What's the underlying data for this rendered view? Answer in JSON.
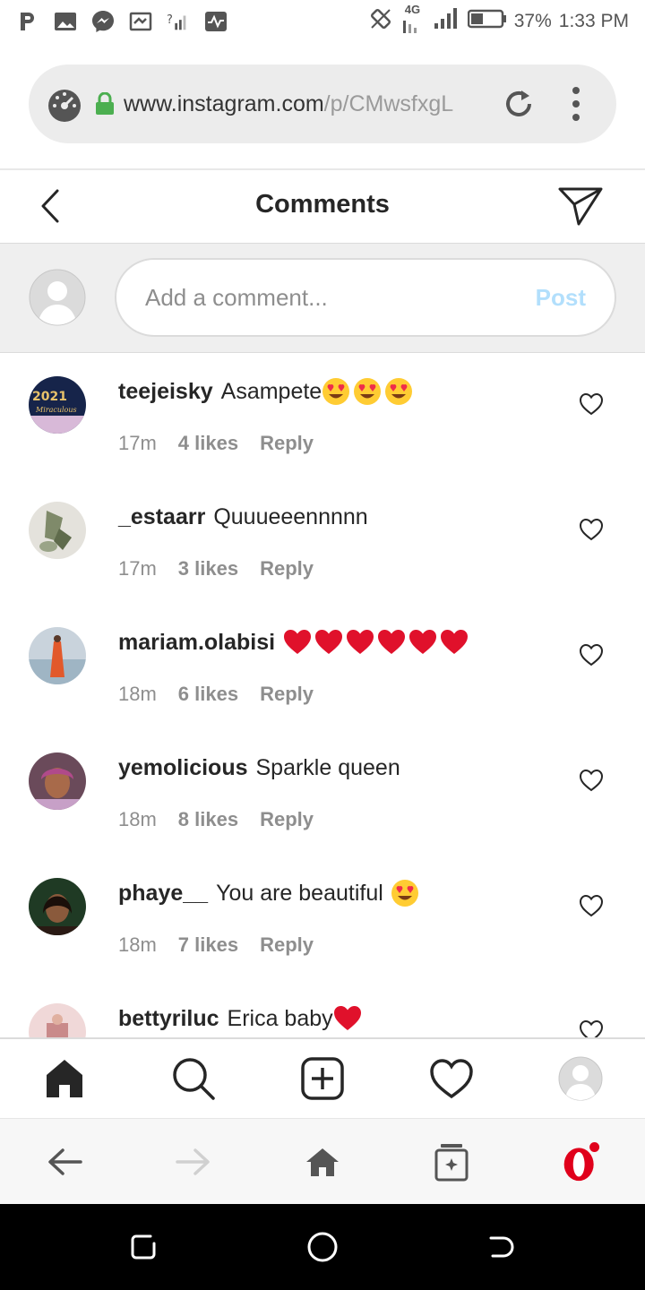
{
  "status_bar": {
    "network": "4G",
    "battery": "37%",
    "time": "1:33 PM"
  },
  "browser": {
    "url_host": "www.instagram.com",
    "url_path": "/p/CMwsfxgL",
    "reload_icon": "reload-icon",
    "menu_icon": "more-vert-icon"
  },
  "header": {
    "title": "Comments"
  },
  "compose": {
    "placeholder": "Add a comment...",
    "post_label": "Post"
  },
  "comments": [
    {
      "user": "teejeisky",
      "text": "Asampete",
      "emoji": [
        "heart-eyes",
        "heart-eyes",
        "heart-eyes"
      ],
      "time": "17m",
      "likes": "4 likes",
      "reply": "Reply"
    },
    {
      "user": "_estaarr",
      "text": "Quuueeennnnn",
      "emoji": [],
      "time": "17m",
      "likes": "3 likes",
      "reply": "Reply"
    },
    {
      "user": "mariam.olabisi",
      "text": "",
      "emoji": [
        "red-heart",
        "red-heart",
        "red-heart",
        "red-heart",
        "red-heart",
        "red-heart"
      ],
      "time": "18m",
      "likes": "6 likes",
      "reply": "Reply"
    },
    {
      "user": "yemolicious",
      "text": "Sparkle queen",
      "emoji": [],
      "time": "18m",
      "likes": "8 likes",
      "reply": "Reply"
    },
    {
      "user": "phaye__",
      "text": "You are beautiful",
      "emoji": [
        "heart-eyes"
      ],
      "time": "18m",
      "likes": "7 likes",
      "reply": "Reply"
    },
    {
      "user": "bettyriluc",
      "text": "Erica baby",
      "emoji": [
        "red-heart"
      ],
      "time": "",
      "likes": "",
      "reply": ""
    }
  ],
  "colors": {
    "accent_post_disabled": "#b2dffc",
    "secure_green": "#4caf50",
    "opera_red": "#e0001b",
    "heart_red": "#e0112b"
  }
}
